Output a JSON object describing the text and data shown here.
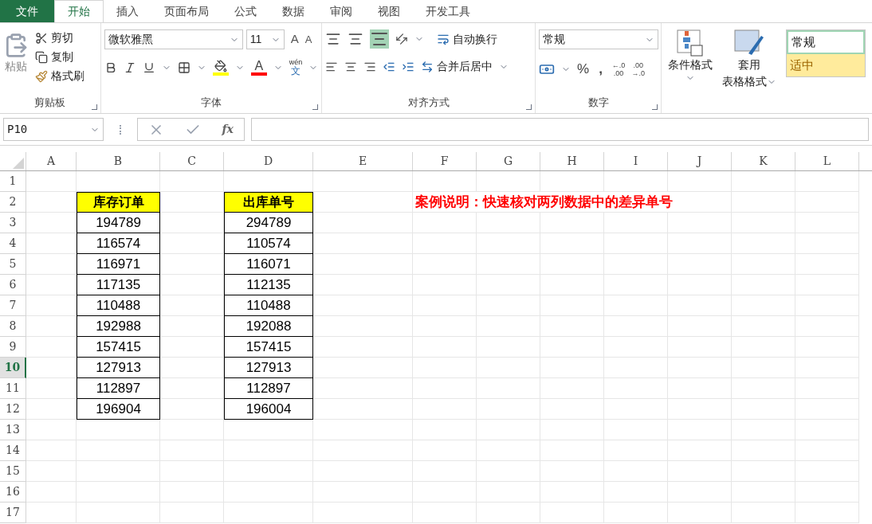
{
  "tabs": [
    {
      "label": "文件",
      "kind": "file",
      "selected": false
    },
    {
      "label": "开始",
      "kind": "tab",
      "selected": true
    },
    {
      "label": "插入",
      "kind": "tab",
      "selected": false
    },
    {
      "label": "页面布局",
      "kind": "tab",
      "selected": false
    },
    {
      "label": "公式",
      "kind": "tab",
      "selected": false
    },
    {
      "label": "数据",
      "kind": "tab",
      "selected": false
    },
    {
      "label": "审阅",
      "kind": "tab",
      "selected": false
    },
    {
      "label": "视图",
      "kind": "tab",
      "selected": false
    },
    {
      "label": "开发工具",
      "kind": "tab",
      "selected": false
    }
  ],
  "clipboard": {
    "label": "剪贴板",
    "paste": "粘贴",
    "cut": "剪切",
    "copy": "复制",
    "format_painter": "格式刷"
  },
  "font": {
    "label": "字体",
    "name": "微软雅黑",
    "size": "11",
    "grow": "A",
    "shrink": "A",
    "color_letter": "A",
    "phonetic": "wén",
    "phonetic_char": "文"
  },
  "alignment": {
    "label": "对齐方式",
    "wrap": "自动换行",
    "merge": "合并后居中",
    "bottom_align_selected": true
  },
  "number": {
    "label": "数字",
    "format": "常规",
    "percent": "%",
    "comma": ",",
    "inc_top": "←.0",
    "inc_bottom": ".00",
    "dec_top": ".00",
    "dec_bottom": "→.0"
  },
  "styles": {
    "conditional": "条件格式",
    "table_top": "套用",
    "table_bottom": "表格格式",
    "style_normal": "常规",
    "style_neutral": "适中"
  },
  "name_box": "P10",
  "fx": "fx",
  "columns": [
    {
      "label": "A"
    },
    {
      "label": "B"
    },
    {
      "label": "C"
    },
    {
      "label": "D"
    },
    {
      "label": "E"
    },
    {
      "label": "F"
    },
    {
      "label": "G"
    },
    {
      "label": "H"
    },
    {
      "label": "I"
    },
    {
      "label": "J"
    },
    {
      "label": "K"
    },
    {
      "label": "L"
    }
  ],
  "rows": [
    {
      "label": "1",
      "selected": false
    },
    {
      "label": "2",
      "selected": false
    },
    {
      "label": "3",
      "selected": false
    },
    {
      "label": "4",
      "selected": false
    },
    {
      "label": "5",
      "selected": false
    },
    {
      "label": "6",
      "selected": false
    },
    {
      "label": "7",
      "selected": false
    },
    {
      "label": "8",
      "selected": false
    },
    {
      "label": "9",
      "selected": false
    },
    {
      "label": "10",
      "selected": true
    },
    {
      "label": "11",
      "selected": false
    },
    {
      "label": "12",
      "selected": false
    },
    {
      "label": "13",
      "selected": false
    },
    {
      "label": "14",
      "selected": false
    },
    {
      "label": "15",
      "selected": false
    },
    {
      "label": "16",
      "selected": false
    },
    {
      "label": "17",
      "selected": false
    }
  ],
  "stock_orders": {
    "header": "库存订单",
    "values": [
      "194789",
      "116574",
      "116971",
      "117135",
      "110488",
      "192988",
      "157415",
      "127913",
      "112897",
      "196904"
    ]
  },
  "outbound_numbers": {
    "header": "出库单号",
    "values": [
      "294789",
      "110574",
      "116071",
      "112135",
      "110488",
      "192088",
      "157415",
      "127913",
      "112897",
      "196004"
    ]
  },
  "note": "案例说明：快速核对两列数据中的差异单号"
}
